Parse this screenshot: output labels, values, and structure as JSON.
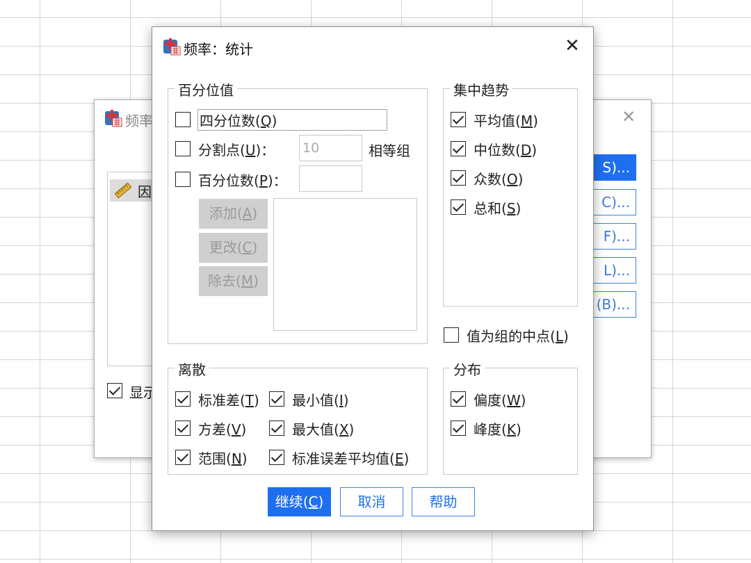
{
  "background_dialog": {
    "title": "频率",
    "list_item": "因",
    "side_buttons": [
      "S)...",
      "C)...",
      "F)...",
      "L)...",
      "(B)..."
    ],
    "show_label": "显示"
  },
  "dialog": {
    "title": "频率：统计",
    "percentile_group": {
      "legend": "百分位值",
      "quartiles": {
        "label": "四分位数(",
        "key": "Q",
        "close": ")",
        "checked": false
      },
      "cut_points": {
        "label": "分割点(",
        "key": "U",
        "close": ")：",
        "value": "10",
        "suffix": "相等组",
        "checked": false
      },
      "percentiles": {
        "label": "百分位数(",
        "key": "P",
        "close": ")：",
        "value": "",
        "checked": false
      },
      "add_button": {
        "label": "添加(",
        "key": "A",
        "close": ")"
      },
      "change_button": {
        "label": "更改(",
        "key": "C",
        "close": ")"
      },
      "remove_button": {
        "label": "除去(",
        "key": "M",
        "close": ")"
      }
    },
    "central_group": {
      "legend": "集中趋势",
      "mean": {
        "label": "平均值(",
        "key": "M",
        "close": ")",
        "checked": true
      },
      "median": {
        "label": "中位数(",
        "key": "D",
        "close": ")",
        "checked": true
      },
      "mode": {
        "label": "众数(",
        "key": "O",
        "close": ")",
        "checked": true
      },
      "sum": {
        "label": "总和(",
        "key": "S",
        "close": ")",
        "checked": true
      }
    },
    "midpoint": {
      "label": "值为组的中点(",
      "key": "L",
      "close": ")",
      "checked": false
    },
    "dispersion_group": {
      "legend": "离散",
      "std_dev": {
        "label": "标准差(",
        "key": "T",
        "close": ")",
        "checked": true
      },
      "minimum": {
        "label": "最小值(",
        "key": "I",
        "close": ")",
        "checked": true
      },
      "variance": {
        "label": "方差(",
        "key": "V",
        "close": ")",
        "checked": true
      },
      "maximum": {
        "label": "最大值(",
        "key": "X",
        "close": ")",
        "checked": true
      },
      "range": {
        "label": "范围(",
        "key": "N",
        "close": ")",
        "checked": true
      },
      "se_mean": {
        "label": "标准误差平均值(",
        "key": "E",
        "close": ")",
        "checked": true
      }
    },
    "distribution_group": {
      "legend": "分布",
      "skewness": {
        "label": "偏度(",
        "key": "W",
        "close": ")",
        "checked": true
      },
      "kurtosis": {
        "label": "峰度(",
        "key": "K",
        "close": ")",
        "checked": true
      }
    },
    "buttons": {
      "continue": {
        "label": "继续(",
        "key": "C",
        "close": ")"
      },
      "cancel": "取消",
      "help": "帮助"
    }
  }
}
